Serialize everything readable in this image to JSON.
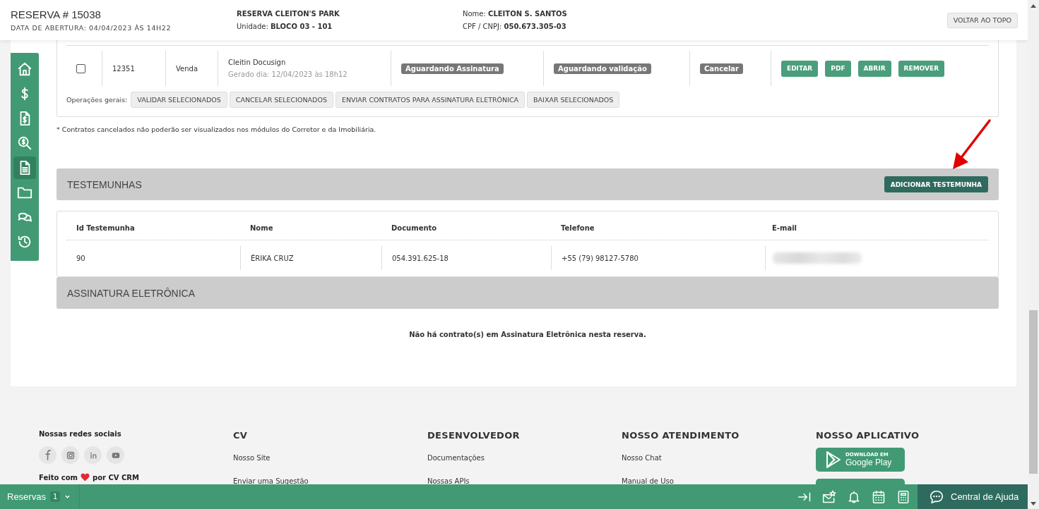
{
  "header": {
    "title": "RESERVA # 15038",
    "opened": "DATA DE ABERTURA: 04/04/2023 ÀS 14H22",
    "project": "RESERVA CLEITON'S PARK",
    "unit": "Unidade: **BLOCO 03 - 101**",
    "name": "Nome: **CLEITON S. SANTOS**",
    "document": "CPF / CNPJ: **050.673.305-03**",
    "back_to_top": "VOLTAR AO TOPO"
  },
  "sidebar": {
    "items": [
      {
        "selected": false
      },
      {
        "selected": false
      },
      {
        "selected": false
      },
      {
        "selected": false
      },
      {
        "selected": true
      },
      {
        "selected": false
      },
      {
        "selected": false
      },
      {
        "selected": false
      }
    ]
  },
  "contracts": {
    "rows": [
      {
        "checked": false,
        "id": "12351",
        "type": "Venda",
        "name": "Cleitin Docusign",
        "generated": "Gerado dia: 12/04/2023 às 18h12",
        "status": "Aguardando Assinatura",
        "validation": "Aguardando validação",
        "cancel": "Cancelar",
        "actions": [
          "EDITAR",
          "PDF",
          "ABRIR",
          "REMOVER"
        ]
      }
    ],
    "operations_label": "Operações gerais:",
    "operations": [
      "VALIDAR SELECIONADOS",
      "CANCELAR SELECIONADOS",
      "ENVIAR CONTRATOS PARA ASSINATURA ELETRÔNICA",
      "BAIXAR SELECIONADOS"
    ],
    "note": "* Contratos cancelados não poderão ser visualizados nos módulos do Corretor e da Imobiliária."
  },
  "witnesses": {
    "title": "TESTEMUNHAS",
    "add_button": "ADICIONAR TESTEMUNHA",
    "columns": [
      "Id Testemunha",
      "Nome",
      "Documento",
      "Telefone",
      "E-mail"
    ],
    "rows": [
      {
        "cells": [
          "90",
          "ÉRIKA CRUZ",
          "054.391.625-18",
          "+55 (79) 98127-5780"
        ],
        "email_hidden": true
      }
    ]
  },
  "electronic_signature": {
    "title": "ASSINATURA ELETRÔNICA",
    "empty_message": "Não há contrato(s) em Assinatura Eletrônica nesta reserva."
  },
  "annotation": {
    "kind": "arrow"
  },
  "footer": {
    "social_title": "Nossas redes sociais",
    "made_with": "Feito com",
    "made_by": "por CV CRM",
    "columns": [
      {
        "title": "CV",
        "links": [
          "Nosso Site",
          "Enviar uma Sugestão"
        ]
      },
      {
        "title": "DESENVOLVEDOR",
        "links": [
          "Documentações",
          "Nossas APIs"
        ]
      },
      {
        "title": "NOSSO ATENDIMENTO",
        "links": [
          "Nosso Chat",
          "Manual de Uso"
        ]
      }
    ],
    "app": {
      "title": "NOSSO APLICATIVO",
      "badge_small": "DOWNLOAD EM",
      "badge_store": "Google Play",
      "second_badge": true
    }
  },
  "bottom_bar": {
    "module": "Reservas",
    "count": "1",
    "help": "Central de Ajuda"
  }
}
